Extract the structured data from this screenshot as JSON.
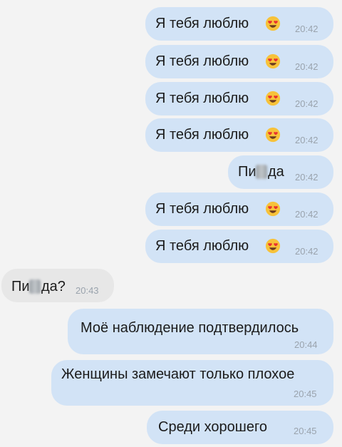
{
  "messages": [
    {
      "dir": "out",
      "text": "Я тебя люблю",
      "emoji": "heart-eyes",
      "time": "20:42"
    },
    {
      "dir": "out",
      "text": "Я тебя люблю",
      "emoji": "heart-eyes",
      "time": "20:42"
    },
    {
      "dir": "out",
      "text": "Я тебя люблю",
      "emoji": "heart-eyes",
      "time": "20:42"
    },
    {
      "dir": "out",
      "text": "Я тебя люблю",
      "emoji": "heart-eyes",
      "time": "20:42"
    },
    {
      "dir": "out",
      "text_start": "Пи",
      "text_end": "да",
      "censored": true,
      "time": "20:42"
    },
    {
      "dir": "out",
      "text": "Я тебя люблю",
      "emoji": "heart-eyes",
      "time": "20:42"
    },
    {
      "dir": "out",
      "text": "Я тебя люблю",
      "emoji": "heart-eyes",
      "time": "20:42"
    },
    {
      "dir": "in",
      "text_start": "Пи",
      "text_end": "да?",
      "censored": true,
      "time": "20:43"
    },
    {
      "dir": "out",
      "text": "Моё наблюдение подтвердилось",
      "time": "20:44"
    },
    {
      "dir": "out",
      "text": "Женщины замечают только плохое",
      "time": "20:45"
    },
    {
      "dir": "out",
      "text": "Среди хорошего",
      "time": "20:45"
    }
  ],
  "colors": {
    "outgoing_bubble": "#d2e3f6",
    "incoming_bubble": "#e7e7e7",
    "background": "#f3f3f3",
    "timestamp": "#9aa3ad"
  }
}
